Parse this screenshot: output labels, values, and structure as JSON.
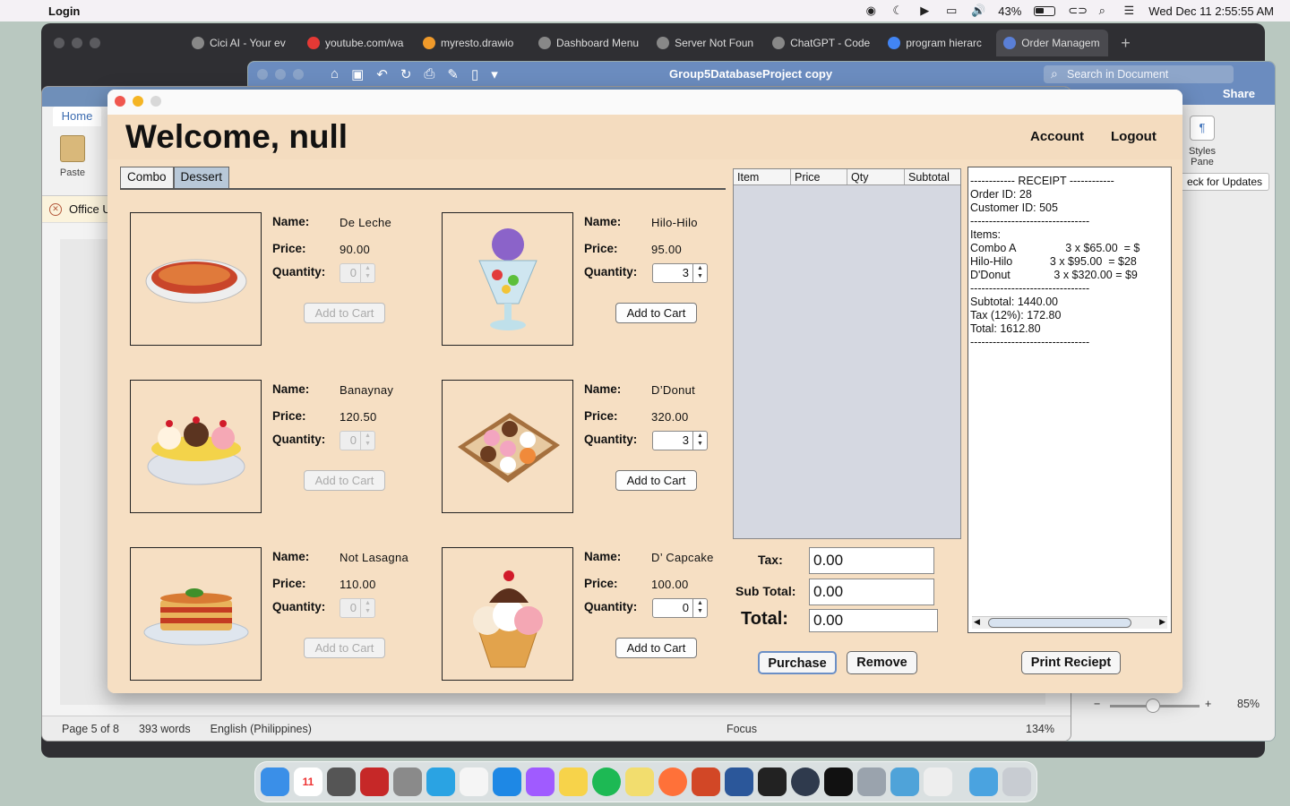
{
  "menubar": {
    "app_name": "Login",
    "battery": "43%",
    "datetime": "Wed Dec 11  2:55:55 AM"
  },
  "browser": {
    "tabs": [
      "Cici AI - Your ev",
      "youtube.com/wa",
      "myresto.drawio",
      "Dashboard Menu",
      "Server Not Foun",
      "ChatGPT - Code",
      "program hierarc",
      "Order Managem"
    ],
    "new_tab": "+"
  },
  "pages": {
    "doc_title": "Group5DatabaseProject copy",
    "search_placeholder": "Search in Document",
    "share_label": "Share",
    "styles_pane": "Styles Pane",
    "check_updates": "eck for Updates",
    "zoom": "85%",
    "zoom_minus": "−",
    "zoom_plus": "+"
  },
  "word": {
    "home_tab": "Home",
    "paste_label": "Paste",
    "office_notice": "Office U",
    "status": {
      "page": "Page 5 of 8",
      "words": "393 words",
      "language": "English (Philippines)",
      "focus": "Focus",
      "zoom": "134%"
    }
  },
  "pos": {
    "welcome": "Welcome, null",
    "account": "Account",
    "logout": "Logout",
    "tabs": [
      "Combo",
      "Dessert"
    ],
    "labels": {
      "name": "Name:",
      "price": "Price:",
      "quantity": "Quantity:",
      "add_to_cart": "Add to Cart"
    },
    "items": [
      {
        "name": "De Leche",
        "price": "90.00",
        "qty": "0",
        "icon": "leche-flan-image",
        "enabled": false
      },
      {
        "name": "Hilo-Hilo",
        "price": "95.00",
        "qty": "3",
        "icon": "halo-halo-image",
        "enabled": true
      },
      {
        "name": "Banaynay",
        "price": "120.50",
        "qty": "0",
        "icon": "banana-split-image",
        "enabled": false
      },
      {
        "name": "D’Donut",
        "price": "320.00",
        "qty": "3",
        "icon": "donut-box-image",
        "enabled": true
      },
      {
        "name": "Not Lasagna",
        "price": "110.00",
        "qty": "0",
        "icon": "lasagna-image",
        "enabled": false
      },
      {
        "name": "D’ Capcake",
        "price": "100.00",
        "qty": "0",
        "icon": "ice-cream-sundae-image",
        "enabled": true
      }
    ],
    "cart_table": {
      "columns": [
        "Item",
        "Price",
        "Qty",
        "Subtotal"
      ],
      "rows": []
    },
    "summary": {
      "tax_label": "Tax:",
      "tax_value": "0.00",
      "subtotal_label": "Sub Total:",
      "subtotal_value": "0.00",
      "total_label": "Total:",
      "total_value": "0.00"
    },
    "buttons": {
      "purchase": "Purchase",
      "remove": "Remove",
      "print": "Print Reciept"
    },
    "receipt_text": "------------ RECEIPT ------------\nOrder ID: 28\nCustomer ID: 505\n--------------------------------\nItems:\nCombo A                3 x $65.00  = $\nHilo-Hilo            3 x $95.00  = $28\nD'Donut              3 x $320.00 = $9\n--------------------------------\nSubtotal: 1440.00\nTax (12%): 172.80\nTotal: 1612.80\n--------------------------------"
  },
  "colors": {
    "pos_background": "#f4dcbf",
    "selected_tab": "#b8c8d8",
    "cart_area": "#d5d8e1",
    "pages_titlebar": "#6b8cbf"
  },
  "dock_apps": [
    "finder-icon",
    "calendar-icon",
    "calculator-icon",
    "photo-booth-icon",
    "system-settings-icon",
    "telegram-icon",
    "reminders-icon",
    "safari-icon",
    "messenger-icon",
    "notes-icon",
    "spotify-icon",
    "stickies-icon",
    "firefox-icon",
    "powerpoint-icon",
    "word-icon",
    "vs-icon",
    "quicktime-icon",
    "terminal-icon",
    "settings-icon",
    "netbeans-icon",
    "java-icon",
    "downloads-icon",
    "trash-icon"
  ]
}
